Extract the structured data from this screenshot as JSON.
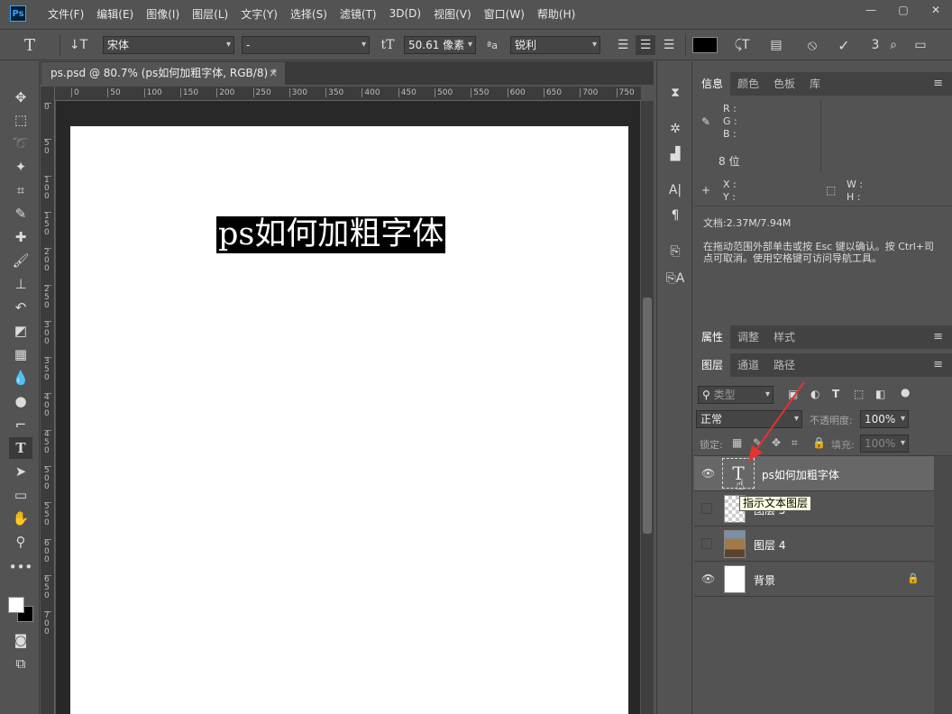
{
  "menubar": {
    "logo": "Ps",
    "items": [
      "文件(F)",
      "编辑(E)",
      "图像(I)",
      "图层(L)",
      "文字(Y)",
      "选择(S)",
      "滤镜(T)",
      "3D(D)",
      "视图(V)",
      "窗口(W)",
      "帮助(H)"
    ]
  },
  "window_controls": {
    "minimize": "—",
    "restore": "▢",
    "close": "✕"
  },
  "options": {
    "font_family": "宋体",
    "font_style": "-",
    "font_size": "50.61 像素",
    "aa_label": "ªa",
    "antialias": "锐利",
    "color_swatch": "#000000"
  },
  "document": {
    "tab_title": "ps.psd @ 80.7% (ps如何加粗字体, RGB/8) *",
    "close": "×",
    "canvas_text": "ps如何加粗字体",
    "ruler_h": [
      "0",
      "50",
      "100",
      "150",
      "200",
      "250",
      "300",
      "350",
      "400",
      "450",
      "500",
      "550",
      "600",
      "650",
      "700",
      "750"
    ],
    "ruler_v": [
      "0",
      "5 0",
      "1 0 0",
      "1 5 0",
      "2 0 0",
      "2 5 0",
      "3 0 0",
      "3 5 0",
      "4 0 0",
      "4 5 0",
      "5 0 0",
      "5 5 0",
      "6 0 0",
      "6 5 0",
      "7 0 0"
    ]
  },
  "info_panel": {
    "tabs": [
      "信息",
      "颜色",
      "色板",
      "库"
    ],
    "r": "R :",
    "g": "G :",
    "b": "B :",
    "bit": "8 位",
    "x": "X :",
    "y": "Y :",
    "w": "W :",
    "h": "H :",
    "doc": "文档:2.37M/7.94M",
    "hint": "在拖动范围外部单击或按 Esc 键以确认。按 Ctrl+司点可取消。使用空格键可访问导航工具。"
  },
  "props_panel": {
    "tabs": [
      "属性",
      "调整",
      "样式"
    ]
  },
  "layers_panel": {
    "tabs": [
      "图层",
      "通道",
      "路径"
    ],
    "filter_placeholder": "类型",
    "blend_mode": "正常",
    "opacity_label": "不透明度:",
    "opacity": "100%",
    "lock_label": "锁定:",
    "fill_label": "填充:",
    "fill": "100%",
    "layers": [
      {
        "name": "ps如何加粗字体",
        "visible": true,
        "type": "text"
      },
      {
        "name": "图层 5",
        "visible": false,
        "type": "transparent"
      },
      {
        "name": "图层 4",
        "visible": false,
        "type": "photo"
      },
      {
        "name": "背景",
        "visible": true,
        "type": "background"
      }
    ],
    "tooltip": "指示文本图层"
  },
  "colors": {
    "accent_arrow": "#e53232"
  }
}
